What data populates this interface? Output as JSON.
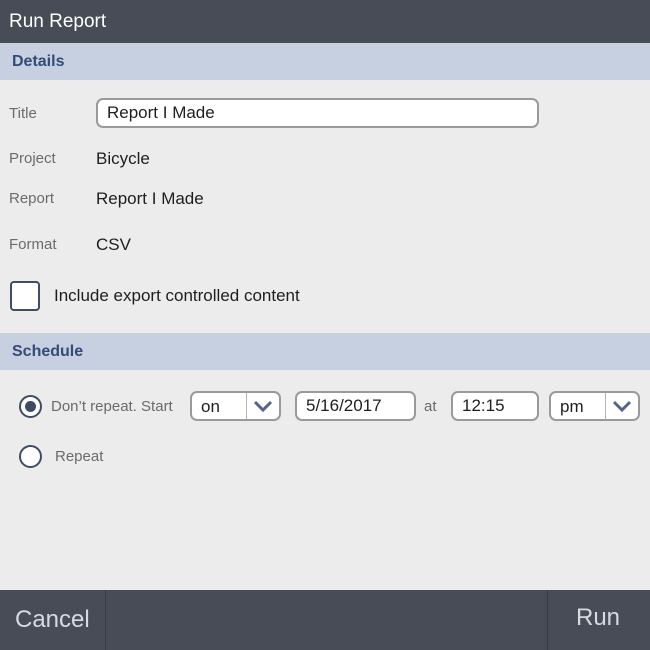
{
  "window": {
    "title": "Run Report"
  },
  "details": {
    "header": "Details",
    "title_label": "Title",
    "title_value": "Report I Made",
    "project_label": "Project",
    "project_value": "Bicycle",
    "report_label": "Report",
    "report_value": "Report I Made",
    "format_label": "Format",
    "format_value": "CSV",
    "export_controlled_label": "Include export controlled content",
    "export_controlled_checked": false
  },
  "schedule": {
    "header": "Schedule",
    "dont_repeat_label": "Don’t repeat. Start",
    "dont_repeat_selected": true,
    "start_mode_value": "on",
    "start_date_value": "5/16/2017",
    "at_label": "at",
    "start_time_value": "12:15",
    "ampm_value": "pm",
    "repeat_label": "Repeat",
    "repeat_selected": false
  },
  "footer": {
    "cancel_label": "Cancel",
    "run_label": "Run"
  },
  "colors": {
    "titlebar": "#474c56",
    "section_header": "#c7d0e0",
    "accent": "#3f4c66"
  }
}
